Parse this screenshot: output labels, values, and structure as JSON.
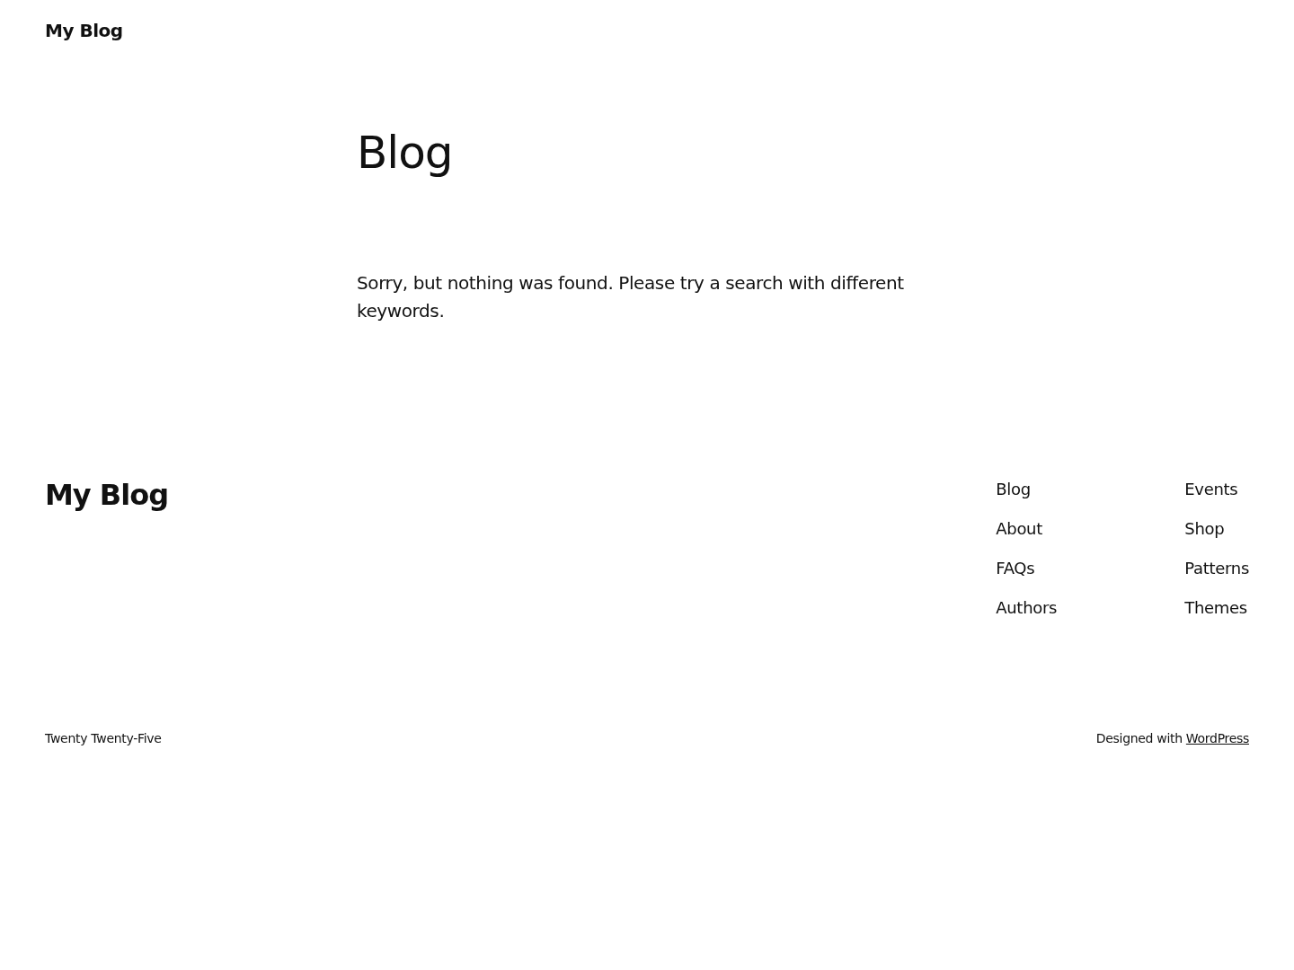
{
  "header": {
    "site_title": "My Blog"
  },
  "main": {
    "title": "Blog",
    "message": "Sorry, but nothing was found. Please try a search with different keywords."
  },
  "footer": {
    "site_title": "My Blog",
    "nav_columns": [
      {
        "links": [
          "Blog",
          "About",
          "FAQs",
          "Authors"
        ]
      },
      {
        "links": [
          "Events",
          "Shop",
          "Patterns",
          "Themes"
        ]
      }
    ],
    "theme_name": "Twenty Twenty-Five",
    "credit_prefix": "Designed with",
    "credit_link": "WordPress"
  }
}
